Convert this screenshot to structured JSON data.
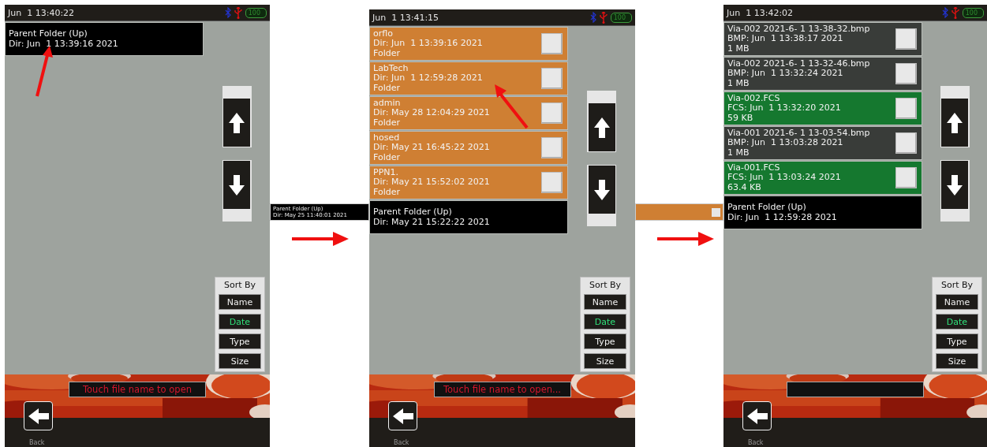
{
  "screens": [
    {
      "status": {
        "time": "Jun  1 13:40:22",
        "battery": "100"
      },
      "entries": [
        {
          "kind": "parent",
          "name": "Parent Folder (Up)",
          "detail": "Dir: Jun  1 13:39:16 2021",
          "pointer": true
        }
      ],
      "sort": {
        "title": "Sort By",
        "options": [
          {
            "label": "Name",
            "selected": false
          },
          {
            "label": "Date",
            "selected": true
          },
          {
            "label": "Type",
            "selected": false
          },
          {
            "label": "Size",
            "selected": false
          }
        ]
      },
      "message": "Touch file name to open",
      "back": "Back"
    },
    {
      "status": {
        "time": "Jun  1 13:41:15",
        "battery": "100"
      },
      "entries": [
        {
          "kind": "folder",
          "name": "orflo",
          "detail": "Dir: Jun  1 13:39:16 2021",
          "info": "Folder",
          "checked": false
        },
        {
          "kind": "folder",
          "name": "LabTech",
          "detail": "Dir: Jun  1 12:59:28 2021",
          "info": "Folder",
          "checked": false,
          "pointer": true
        },
        {
          "kind": "folder",
          "name": "admin",
          "detail": "Dir: May 28 12:04:29 2021",
          "info": "Folder",
          "checked": false
        },
        {
          "kind": "folder",
          "name": "hosed",
          "detail": "Dir: May 21 16:45:22 2021",
          "info": "Folder",
          "checked": false
        },
        {
          "kind": "folder",
          "name": "PPN1.",
          "detail": "Dir: May 21 15:52:02 2021",
          "info": "Folder",
          "checked": false
        },
        {
          "kind": "parent",
          "name": "Parent Folder (Up)",
          "detail": "Dir: May 21 15:22:22 2021"
        }
      ],
      "sort": {
        "title": "Sort By",
        "options": [
          {
            "label": "Name",
            "selected": false
          },
          {
            "label": "Date",
            "selected": true
          },
          {
            "label": "Type",
            "selected": false
          },
          {
            "label": "Size",
            "selected": false
          }
        ]
      },
      "message": "Touch file name to open...",
      "back": "Back"
    },
    {
      "status": {
        "time": "Jun  1 13:42:02",
        "battery": "100"
      },
      "entries": [
        {
          "name": "Via-002 2021-6- 1 13-38-32.bmp",
          "detail": "BMP: Jun  1 13:38:17 2021",
          "info": "1 MB",
          "checked": false
        },
        {
          "name": "Via-002 2021-6- 1 13-32-46.bmp",
          "detail": "BMP: Jun  1 13:32:24 2021",
          "info": "1 MB",
          "checked": false
        },
        {
          "kind": "fcs",
          "name": "Via-002.FCS",
          "detail": "FCS: Jun  1 13:32:20 2021",
          "info": "59 KB",
          "checked": false
        },
        {
          "name": "Via-001 2021-6- 1 13-03-54.bmp",
          "detail": "BMP: Jun  1 13:03:28 2021",
          "info": "1 MB",
          "checked": false
        },
        {
          "kind": "fcs",
          "name": "Via-001.FCS",
          "detail": "FCS: Jun  1 13:03:24 2021",
          "info": "63.4 KB",
          "checked": false
        },
        {
          "kind": "parent",
          "name": "Parent Folder (Up)",
          "detail": "Dir: Jun  1 12:59:28 2021"
        }
      ],
      "sort": {
        "title": "Sort By",
        "options": [
          {
            "label": "Name",
            "selected": false
          },
          {
            "label": "Date",
            "selected": true
          },
          {
            "label": "Type",
            "selected": false
          },
          {
            "label": "Size",
            "selected": false
          }
        ]
      },
      "back": "Back"
    }
  ],
  "transitions": [
    {
      "kind": "parent",
      "name": "Parent Folder (Up)",
      "detail": "Dir: May 25 11:40:01 2021"
    },
    {
      "kind": "folder",
      "checked": false
    }
  ]
}
